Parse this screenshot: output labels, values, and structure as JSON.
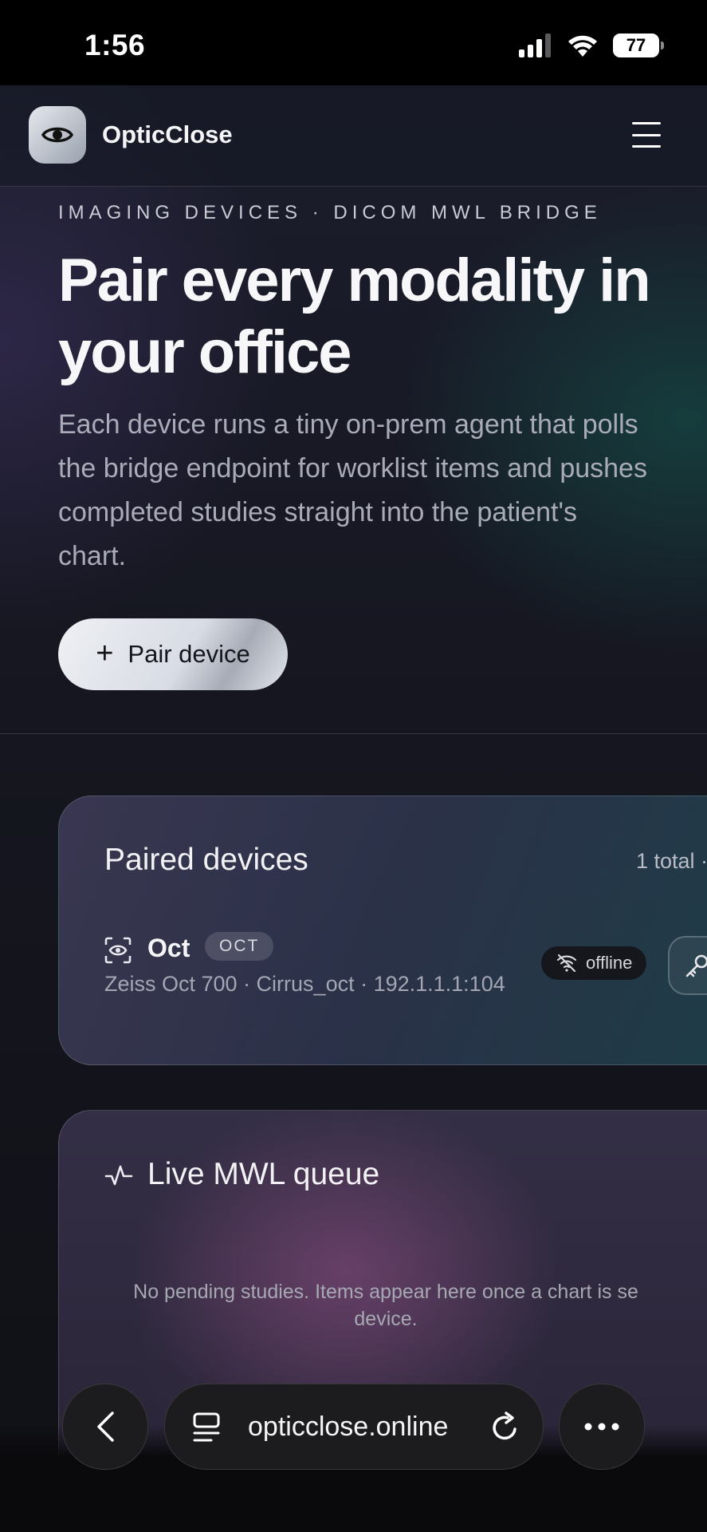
{
  "status_bar": {
    "time": "1:56",
    "battery": "77"
  },
  "header": {
    "brand": "OpticClose",
    "logo_icon": "eye-icon",
    "menu_icon": "hamburger-icon"
  },
  "hero": {
    "eyebrow": "IMAGING DEVICES · DICOM MWL BRIDGE",
    "title": "Pair every modality in your office",
    "description": "Each device runs a tiny on-prem agent that polls the bridge endpoint for worklist items and pushes completed studies straight into the patient's chart.",
    "pair_button_label": "Pair device"
  },
  "paired_devices": {
    "title": "Paired devices",
    "total": "1 total ·",
    "devices": [
      {
        "name": "Oct",
        "tag": "OCT",
        "meta": "Zeiss Oct 700 · Cirrus_oct · 192.1.1.1:104",
        "status": "offline",
        "status_icon": "wifi-off-icon",
        "action_icon": "key-icon"
      }
    ]
  },
  "queue": {
    "title": "Live MWL queue",
    "icon": "activity-icon",
    "empty_text": "No pending studies. Items appear here once a chart is se device."
  },
  "browser": {
    "url": "opticclose.online"
  }
}
